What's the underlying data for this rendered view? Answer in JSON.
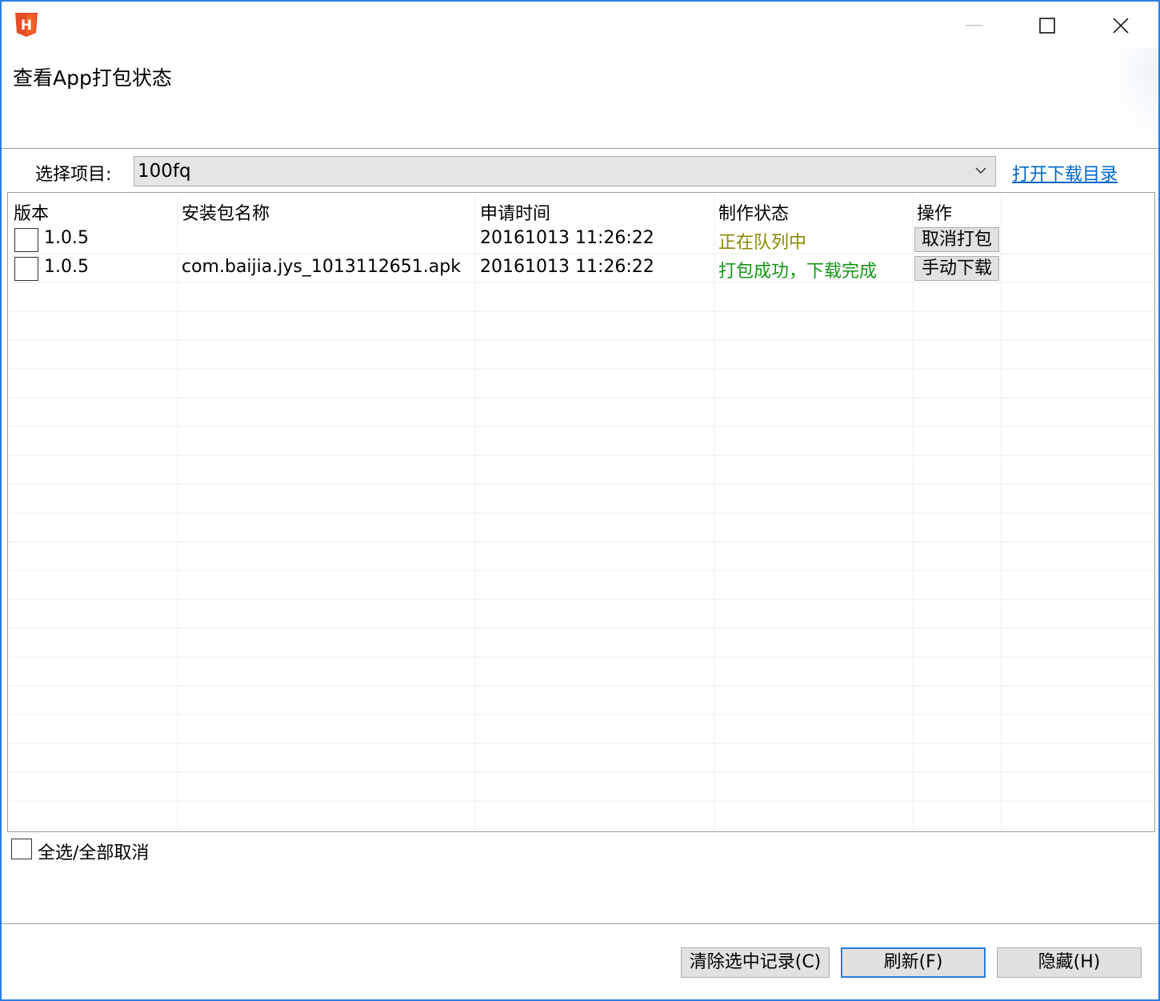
{
  "window": {
    "icon_letter": "H",
    "controls": [
      "minimize",
      "maximize",
      "close"
    ]
  },
  "banner": {
    "title": "查看App打包状态"
  },
  "project": {
    "label": "选择项目:",
    "selected": "100fq",
    "open_dir_link": "打开下载目录"
  },
  "table": {
    "headers": [
      "版本",
      "安装包名称",
      "申请时间",
      "制作状态",
      "操作"
    ],
    "rows": [
      {
        "version": "1.0.5",
        "package": "",
        "time": "20161013 11:26:22",
        "status": "正在队列中",
        "action": "取消打包"
      },
      {
        "version": "1.0.5",
        "package": "com.baijia.jys_1013112651.apk",
        "time": "20161013 11:26:22",
        "status": "打包成功，下载完成",
        "action": "手动下载"
      }
    ]
  },
  "select_all": {
    "label": "全选/全部取消",
    "checked": false
  },
  "footer": {
    "clear": "清除选中记录(C)",
    "refresh": "刷新(F)",
    "hide": "隐藏(H)"
  },
  "colors": {
    "accent": "#2b7de0",
    "link": "#0066cc",
    "status_queue": "#8a8a00",
    "status_done": "#149614",
    "icon_bg": "#e44d26"
  }
}
